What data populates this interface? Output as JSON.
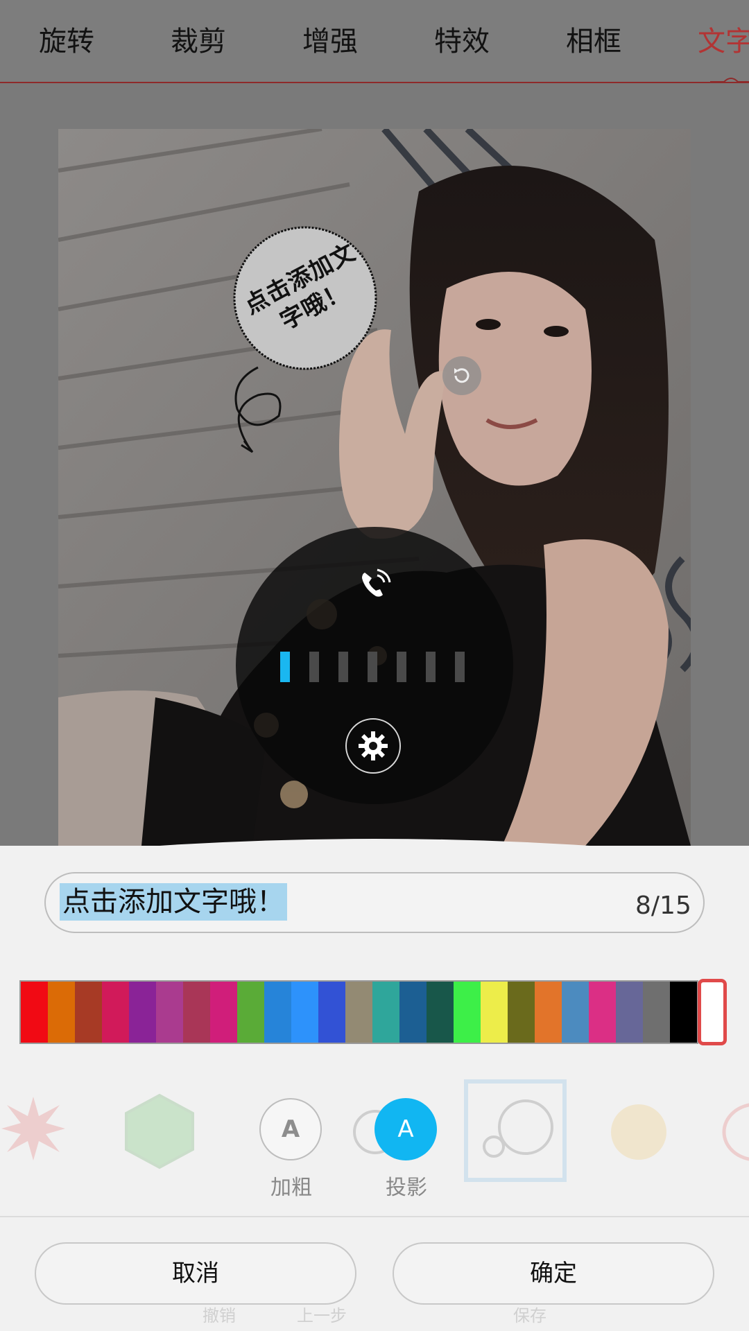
{
  "tabs": [
    {
      "label": "旋转"
    },
    {
      "label": "裁剪"
    },
    {
      "label": "增强"
    },
    {
      "label": "特效"
    },
    {
      "label": "相框"
    },
    {
      "label": "文字"
    }
  ],
  "active_tab": "文字",
  "sticker": {
    "text": "点击添加文字哦！"
  },
  "hud": {
    "icon": "phone-volume-icon",
    "level": 1,
    "steps": 7,
    "settings_icon": "gear-icon"
  },
  "text_input": {
    "value": "点击添加文字哦！",
    "count": "8/15"
  },
  "palette": {
    "colors": [
      "#f10a14",
      "#db6b06",
      "#a73a25",
      "#d11a5a",
      "#8a2397",
      "#aa3b8f",
      "#a93657",
      "#d01e7a",
      "#5aab37",
      "#2684d9",
      "#2d92fb",
      "#3252d5",
      "#938a73",
      "#2fa69b",
      "#1c5f93",
      "#18574a",
      "#3def48",
      "#eded4a",
      "#6a6a1c",
      "#e2742a",
      "#4c8bbf",
      "#db2f85",
      "#676798",
      "#6f6f6f",
      "#000000"
    ],
    "selected": "#ffffff"
  },
  "style_buttons": {
    "bold": {
      "glyph": "A",
      "label": "加粗"
    },
    "shadow": {
      "glyph": "A",
      "label": "投影"
    }
  },
  "actions": {
    "cancel": "取消",
    "confirm": "确定"
  },
  "bottom_faded": {
    "undo": "撤销",
    "prev": "上一步",
    "save": "保存"
  },
  "colors": {
    "accent": "#b23434",
    "shadow_active": "#11b6f2",
    "selection": "#a7d5ee"
  }
}
